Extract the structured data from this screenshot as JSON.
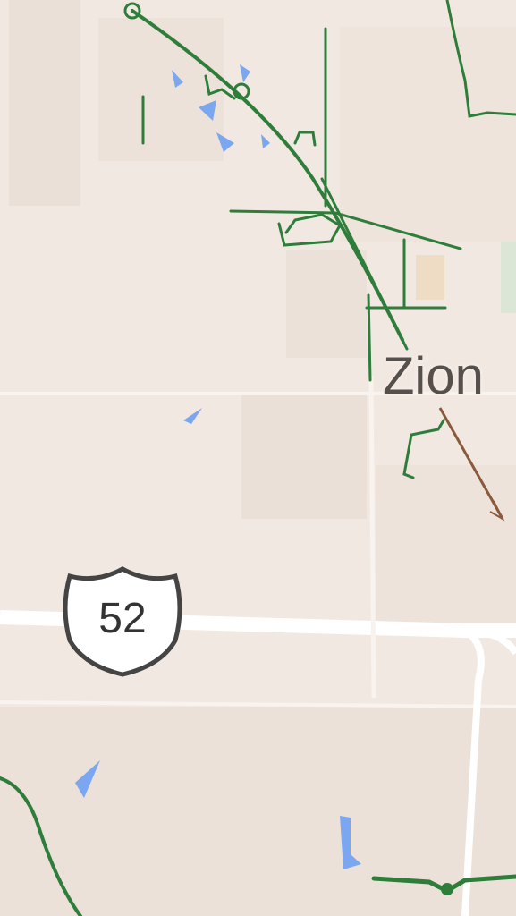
{
  "map": {
    "place_label": "Zion",
    "route_shield": "52",
    "colors": {
      "land": "#f2e8e2",
      "land_dark": "#e9ddd5",
      "road": "#ffffff",
      "trail": "#2e7d3a",
      "water": "#7aa7f0",
      "rail": "#8a5a3c"
    },
    "icons": {
      "route": "us-highway-shield-icon",
      "trail": "trail-line",
      "water": "water-body"
    }
  }
}
